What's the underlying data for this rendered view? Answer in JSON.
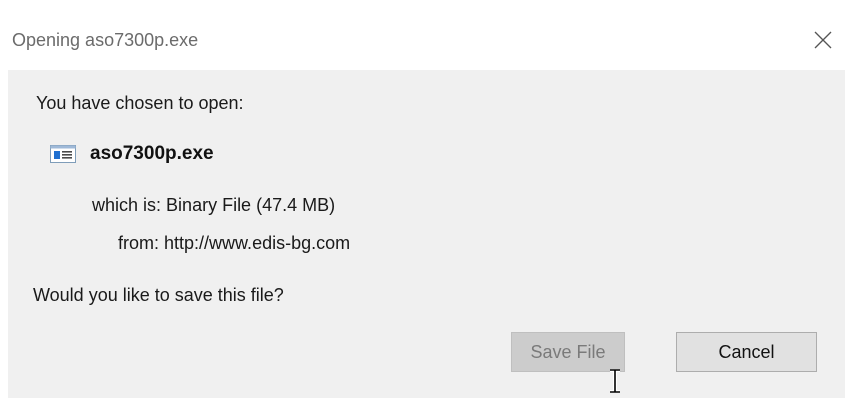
{
  "dialog": {
    "title": "Opening aso7300p.exe",
    "close_icon": "close-icon",
    "prompt": "You have chosen to open:",
    "file": {
      "icon": "executable-file-icon",
      "name": "aso7300p.exe"
    },
    "details": {
      "which_label": "which is:",
      "which_value": "Binary File (47.4 MB)",
      "from_label": "from:",
      "from_value": "http://www.edis-bg.com"
    },
    "question": "Would you like to save this file?",
    "buttons": {
      "save_label": "Save File",
      "save_state": "disabled",
      "cancel_label": "Cancel"
    }
  },
  "colors": {
    "body_background": "#f0f0f0",
    "titlebar_background": "#ffffff",
    "button_background": "#e1e1e1",
    "disabled_button_background": "#cccccc",
    "file_icon_accent": "#1f6fd0"
  },
  "cursor": {
    "icon": "text-cursor-icon"
  }
}
